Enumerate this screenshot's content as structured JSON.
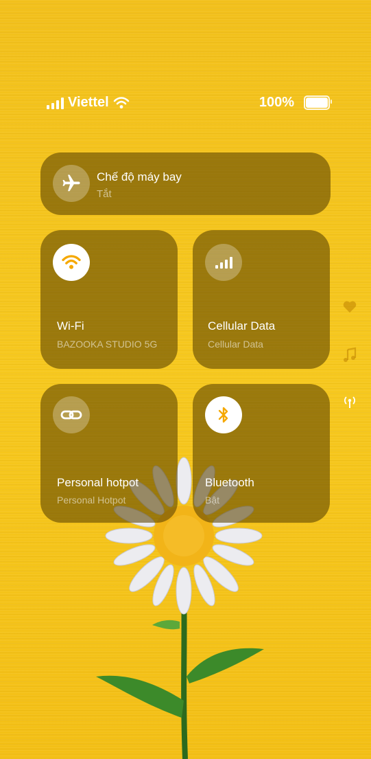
{
  "status_bar": {
    "carrier": "Viettel",
    "battery_percent": "100%"
  },
  "airplane": {
    "title": "Chế độ máy bay",
    "subtitle": "Tắt"
  },
  "wifi": {
    "title": "Wi-Fi",
    "subtitle": "BAZOOKA STUDIO 5G"
  },
  "cellular": {
    "title": "Cellular Data",
    "subtitle": "Cellular Data"
  },
  "hotspot": {
    "title": "Personal hotpot",
    "subtitle": "Personal Hotpot"
  },
  "bluetooth": {
    "title": "Bluetooth",
    "subtitle": "Bật"
  },
  "colors": {
    "accent": "#f5a800",
    "background": "#f4c21a",
    "tile": "#5a4200"
  }
}
